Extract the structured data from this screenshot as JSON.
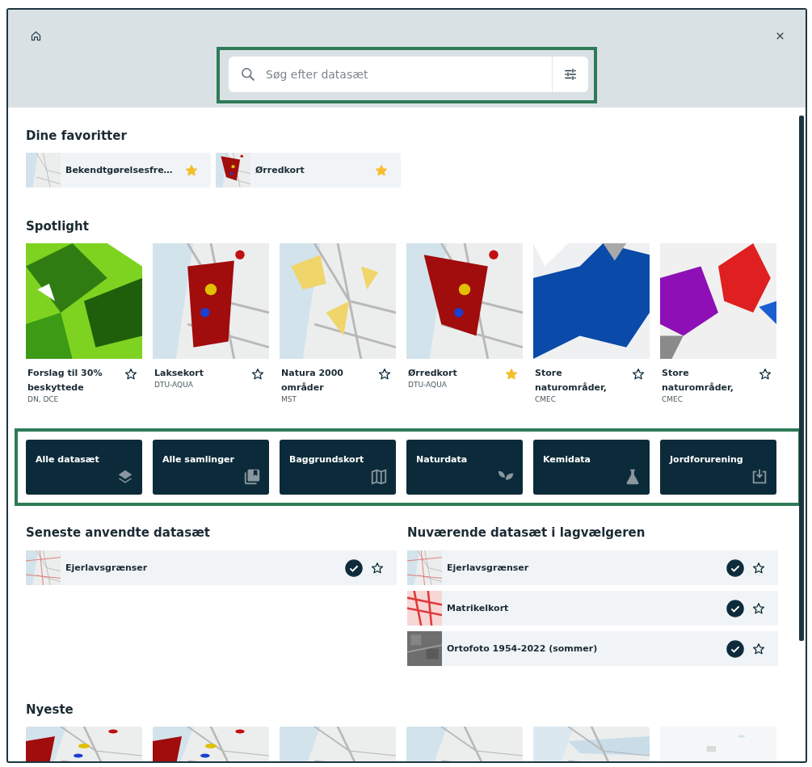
{
  "header": {
    "search": {
      "placeholder": "Søg efter datasæt"
    }
  },
  "favorites": {
    "title": "Dine favoritter",
    "items": [
      {
        "label": "Bekendtgørelsesfre…",
        "favorite": true
      },
      {
        "label": "Ørredkort",
        "favorite": true
      }
    ]
  },
  "spotlight": {
    "title": "Spotlight",
    "items": [
      {
        "title": "Forslag til 30% beskyttede",
        "source": "DN, DCE",
        "favorite": false
      },
      {
        "title": "Laksekort",
        "source": "DTU-AQUA",
        "favorite": false
      },
      {
        "title": "Natura 2000 områder",
        "source": "MST",
        "favorite": false
      },
      {
        "title": "Ørredkort",
        "source": "DTU-AQUA",
        "favorite": true
      },
      {
        "title": "Store naturområder,",
        "source": "CMEC",
        "favorite": false
      },
      {
        "title": "Store naturområder,",
        "source": "CMEC",
        "favorite": false
      }
    ]
  },
  "categories": [
    {
      "label": "Alle datasæt",
      "kind": "layers"
    },
    {
      "label": "Alle samlinger",
      "kind": "collection"
    },
    {
      "label": "Baggrundskort",
      "kind": "map"
    },
    {
      "label": "Naturdata",
      "kind": "sprout"
    },
    {
      "label": "Kemidata",
      "kind": "flask"
    },
    {
      "label": "Jordforurening",
      "kind": "soil"
    }
  ],
  "recent": {
    "title": "Seneste anvendte datasæt",
    "items": [
      {
        "label": "Ejerlavsgrænser",
        "active": true,
        "favorite": false
      }
    ]
  },
  "current": {
    "title": "Nuværende datasæt i lagvælgeren",
    "items": [
      {
        "label": "Ejerlavsgrænser",
        "active": true,
        "favorite": false
      },
      {
        "label": "Matrikelkort",
        "active": true,
        "favorite": false
      },
      {
        "label": "Ortofoto 1954-2022 (sommer)",
        "active": true,
        "favorite": false
      }
    ]
  },
  "newest": {
    "title": "Nyeste"
  }
}
